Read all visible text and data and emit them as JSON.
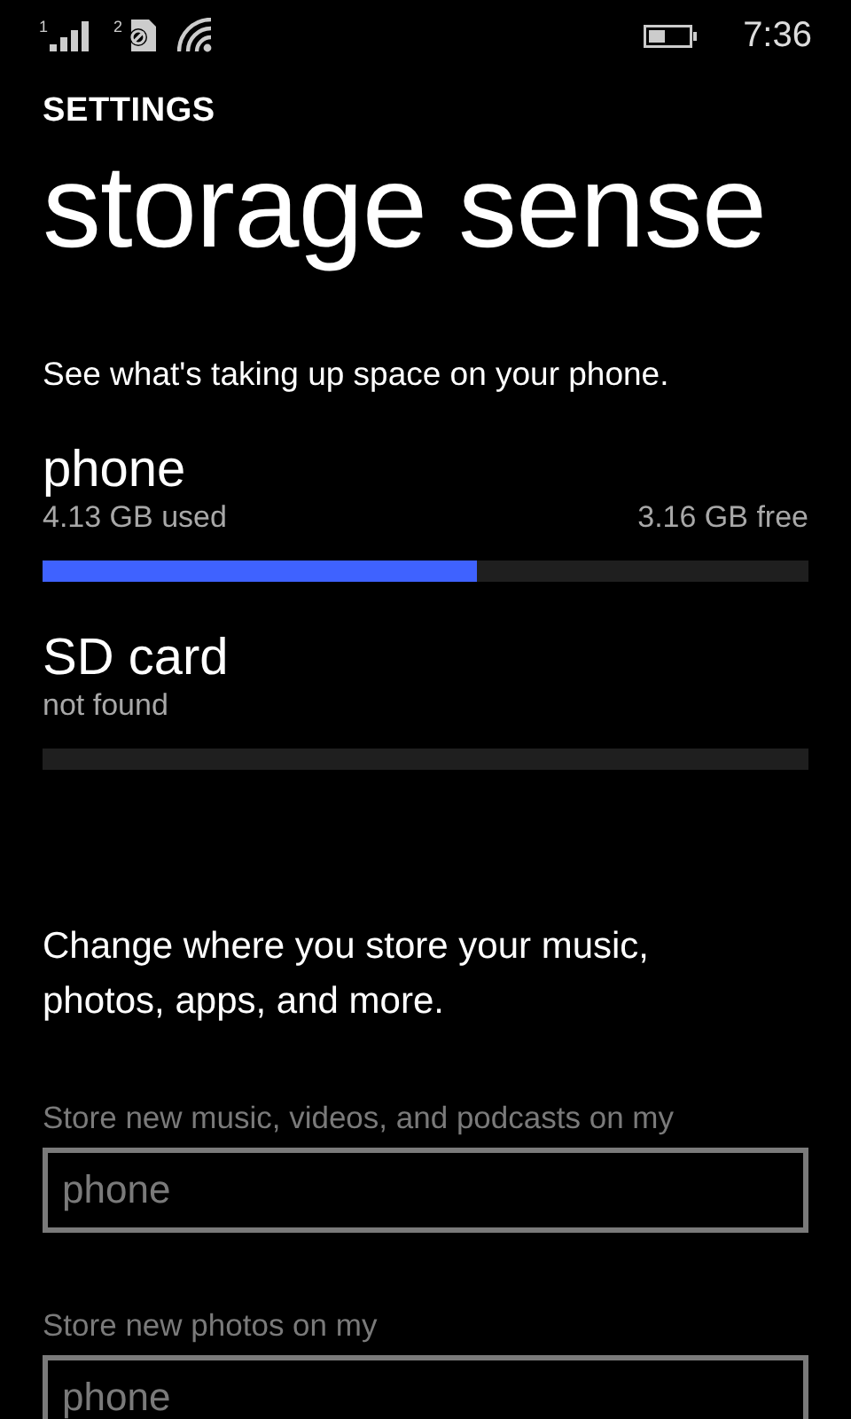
{
  "status_bar": {
    "sim_1": "1",
    "sim_2": "2",
    "time": "7:36"
  },
  "header": {
    "app": "SETTINGS",
    "title": "storage sense"
  },
  "description": "See what's taking up space on your phone.",
  "storages": [
    {
      "name": "phone",
      "used": "4.13 GB used",
      "free": "3.16 GB free",
      "level": 0.567
    },
    {
      "name": "SD card",
      "used": "not found"
    }
  ],
  "locations_intro": "Change where you store your music, photos, apps, and more.",
  "location_pickers": [
    {
      "label": "Store new music, videos, and podcasts on my",
      "value": "phone",
      "disabled": true
    },
    {
      "label": "Store new photos on my",
      "value": "phone",
      "disabled": true
    }
  ]
}
